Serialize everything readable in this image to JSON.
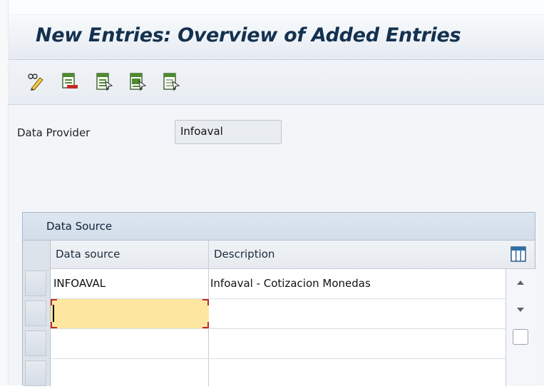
{
  "title": "New Entries: Overview of Added Entries",
  "toolbar": {
    "buttons": [
      {
        "name": "display-change-icon"
      },
      {
        "name": "delete-entry-icon"
      },
      {
        "name": "select-all-icon"
      },
      {
        "name": "select-block-icon"
      },
      {
        "name": "deselect-all-icon"
      }
    ]
  },
  "field": {
    "label": "Data Provider",
    "value": "Infoaval"
  },
  "table": {
    "title": "Data Source",
    "columns": [
      "Data source",
      "Description"
    ],
    "rows": [
      [
        "INFOAVAL",
        "Infoaval - Cotizacion Monedas"
      ],
      [
        "",
        ""
      ],
      [
        "",
        ""
      ],
      [
        "",
        ""
      ]
    ]
  },
  "colors": {
    "title_text": "#14314f",
    "active_cell": "#fde7a0",
    "selection_corner": "#c0282b"
  }
}
